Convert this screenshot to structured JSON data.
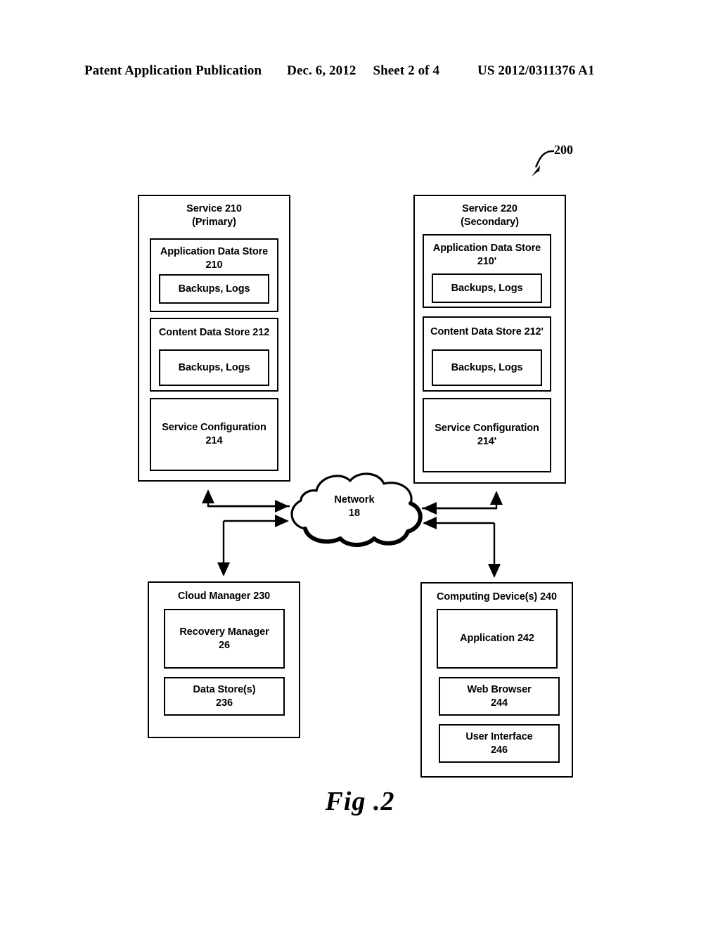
{
  "header": {
    "publication": "Patent Application Publication",
    "date": "Dec. 6, 2012",
    "sheet": "Sheet 2 of 4",
    "patent_number": "US 2012/0311376 A1"
  },
  "figure": {
    "caption": "Fig .2",
    "reference_label": "200"
  },
  "diagram": {
    "service_primary": {
      "title_line1": "Service 210",
      "title_line2": "(Primary)",
      "application_data_store": {
        "line1": "Application Data Store",
        "line2": "210",
        "child": "Backups, Logs"
      },
      "content_data_store": {
        "line1": "Content Data Store 212",
        "child": "Backups, Logs"
      },
      "service_configuration": {
        "line1": "Service Configuration",
        "line2": "214"
      }
    },
    "service_secondary": {
      "title_line1": "Service 220",
      "title_line2": "(Secondary)",
      "application_data_store": {
        "line1": "Application Data Store",
        "line2": "210'",
        "child": "Backups, Logs"
      },
      "content_data_store": {
        "line1": "Content Data Store 212'",
        "child": "Backups, Logs"
      },
      "service_configuration": {
        "line1": "Service Configuration",
        "line2": "214'"
      }
    },
    "network": {
      "line1": "Network",
      "line2": "18"
    },
    "cloud_manager": {
      "title": "Cloud Manager 230",
      "recovery_manager": {
        "line1": "Recovery Manager",
        "line2": "26"
      },
      "data_stores": {
        "line1": "Data Store(s)",
        "line2": "236"
      }
    },
    "computing_devices": {
      "title": "Computing Device(s) 240",
      "application": {
        "line1": "Application 242"
      },
      "web_browser": {
        "line1": "Web Browser",
        "line2": "244"
      },
      "user_interface": {
        "line1": "User Interface",
        "line2": "246"
      }
    }
  }
}
